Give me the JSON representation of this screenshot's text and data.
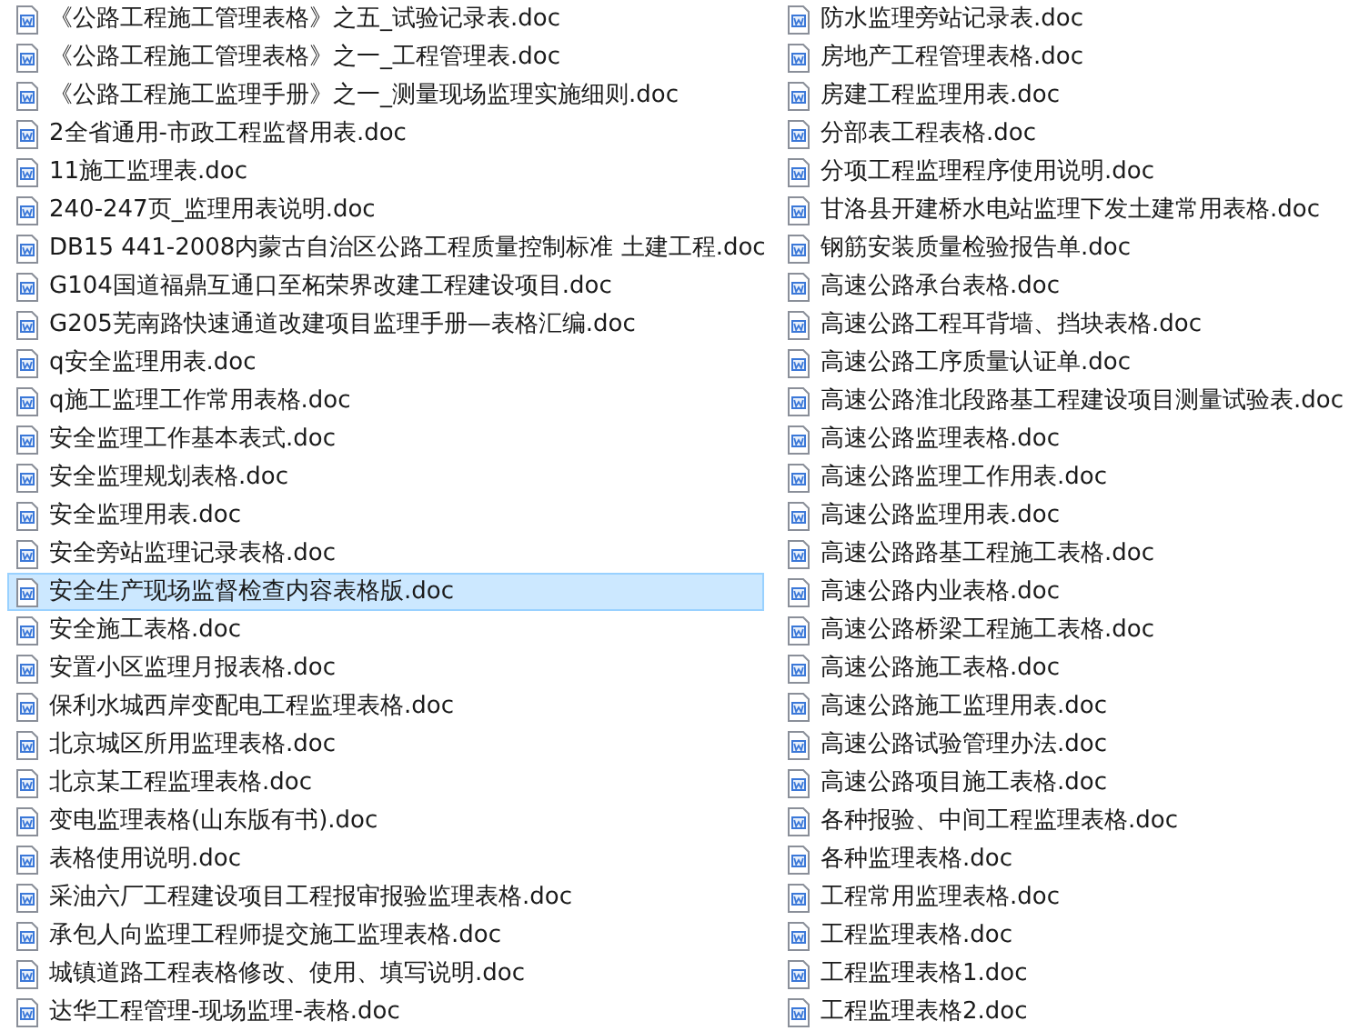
{
  "columns": [
    {
      "files": [
        {
          "name": "《公路工程施工管理表格》之五_试验记录表.doc",
          "selected": false
        },
        {
          "name": "《公路工程施工管理表格》之一_工程管理表.doc",
          "selected": false
        },
        {
          "name": "《公路工程施工监理手册》之一_测量现场监理实施细则.doc",
          "selected": false
        },
        {
          "name": "2全省通用-市政工程监督用表.doc",
          "selected": false
        },
        {
          "name": "11施工监理表.doc",
          "selected": false
        },
        {
          "name": "240-247页_监理用表说明.doc",
          "selected": false
        },
        {
          "name": "DB15 441-2008内蒙古自治区公路工程质量控制标准 土建工程.doc",
          "selected": false
        },
        {
          "name": "G104国道福鼎互通口至柘荣界改建工程建设项目.doc",
          "selected": false
        },
        {
          "name": "G205芜南路快速通道改建项目监理手册—表格汇编.doc",
          "selected": false
        },
        {
          "name": "q安全监理用表.doc",
          "selected": false
        },
        {
          "name": "q施工监理工作常用表格.doc",
          "selected": false
        },
        {
          "name": "安全监理工作基本表式.doc",
          "selected": false
        },
        {
          "name": "安全监理规划表格.doc",
          "selected": false
        },
        {
          "name": "安全监理用表.doc",
          "selected": false
        },
        {
          "name": "安全旁站监理记录表格.doc",
          "selected": false
        },
        {
          "name": "安全生产现场监督检查内容表格版.doc",
          "selected": true
        },
        {
          "name": "安全施工表格.doc",
          "selected": false
        },
        {
          "name": "安置小区监理月报表格.doc",
          "selected": false
        },
        {
          "name": "保利水城西岸变配电工程监理表格.doc",
          "selected": false
        },
        {
          "name": "北京城区所用监理表格.doc",
          "selected": false
        },
        {
          "name": "北京某工程监理表格.doc",
          "selected": false
        },
        {
          "name": "变电监理表格(山东版有书).doc",
          "selected": false
        },
        {
          "name": "表格使用说明.doc",
          "selected": false
        },
        {
          "name": "采油六厂工程建设项目工程报审报验监理表格.doc",
          "selected": false
        },
        {
          "name": "承包人向监理工程师提交施工监理表格.doc",
          "selected": false
        },
        {
          "name": "城镇道路工程表格修改、使用、填写说明.doc",
          "selected": false
        },
        {
          "name": "达华工程管理-现场监理-表格.doc",
          "selected": false
        }
      ]
    },
    {
      "files": [
        {
          "name": "防水监理旁站记录表.doc",
          "selected": false
        },
        {
          "name": "房地产工程管理表格.doc",
          "selected": false
        },
        {
          "name": "房建工程监理用表.doc",
          "selected": false
        },
        {
          "name": "分部表工程表格.doc",
          "selected": false
        },
        {
          "name": "分项工程监理程序使用说明.doc",
          "selected": false
        },
        {
          "name": "甘洛县开建桥水电站监理下发土建常用表格.doc",
          "selected": false
        },
        {
          "name": "钢筋安装质量检验报告单.doc",
          "selected": false
        },
        {
          "name": "高速公路承台表格.doc",
          "selected": false
        },
        {
          "name": "高速公路工程耳背墙、挡块表格.doc",
          "selected": false
        },
        {
          "name": "高速公路工序质量认证单.doc",
          "selected": false
        },
        {
          "name": "高速公路淮北段路基工程建设项目测量试验表.doc",
          "selected": false
        },
        {
          "name": "高速公路监理表格.doc",
          "selected": false
        },
        {
          "name": "高速公路监理工作用表.doc",
          "selected": false
        },
        {
          "name": "高速公路监理用表.doc",
          "selected": false
        },
        {
          "name": "高速公路路基工程施工表格.doc",
          "selected": false
        },
        {
          "name": "高速公路内业表格.doc",
          "selected": false
        },
        {
          "name": "高速公路桥梁工程施工表格.doc",
          "selected": false
        },
        {
          "name": "高速公路施工表格.doc",
          "selected": false
        },
        {
          "name": "高速公路施工监理用表.doc",
          "selected": false
        },
        {
          "name": "高速公路试验管理办法.doc",
          "selected": false
        },
        {
          "name": "高速公路项目施工表格.doc",
          "selected": false
        },
        {
          "name": "各种报验、中间工程监理表格.doc",
          "selected": false
        },
        {
          "name": "各种监理表格.doc",
          "selected": false
        },
        {
          "name": "工程常用监理表格.doc",
          "selected": false
        },
        {
          "name": "工程监理表格.doc",
          "selected": false
        },
        {
          "name": "工程监理表格1.doc",
          "selected": false
        },
        {
          "name": "工程监理表格2.doc",
          "selected": false
        }
      ]
    }
  ]
}
